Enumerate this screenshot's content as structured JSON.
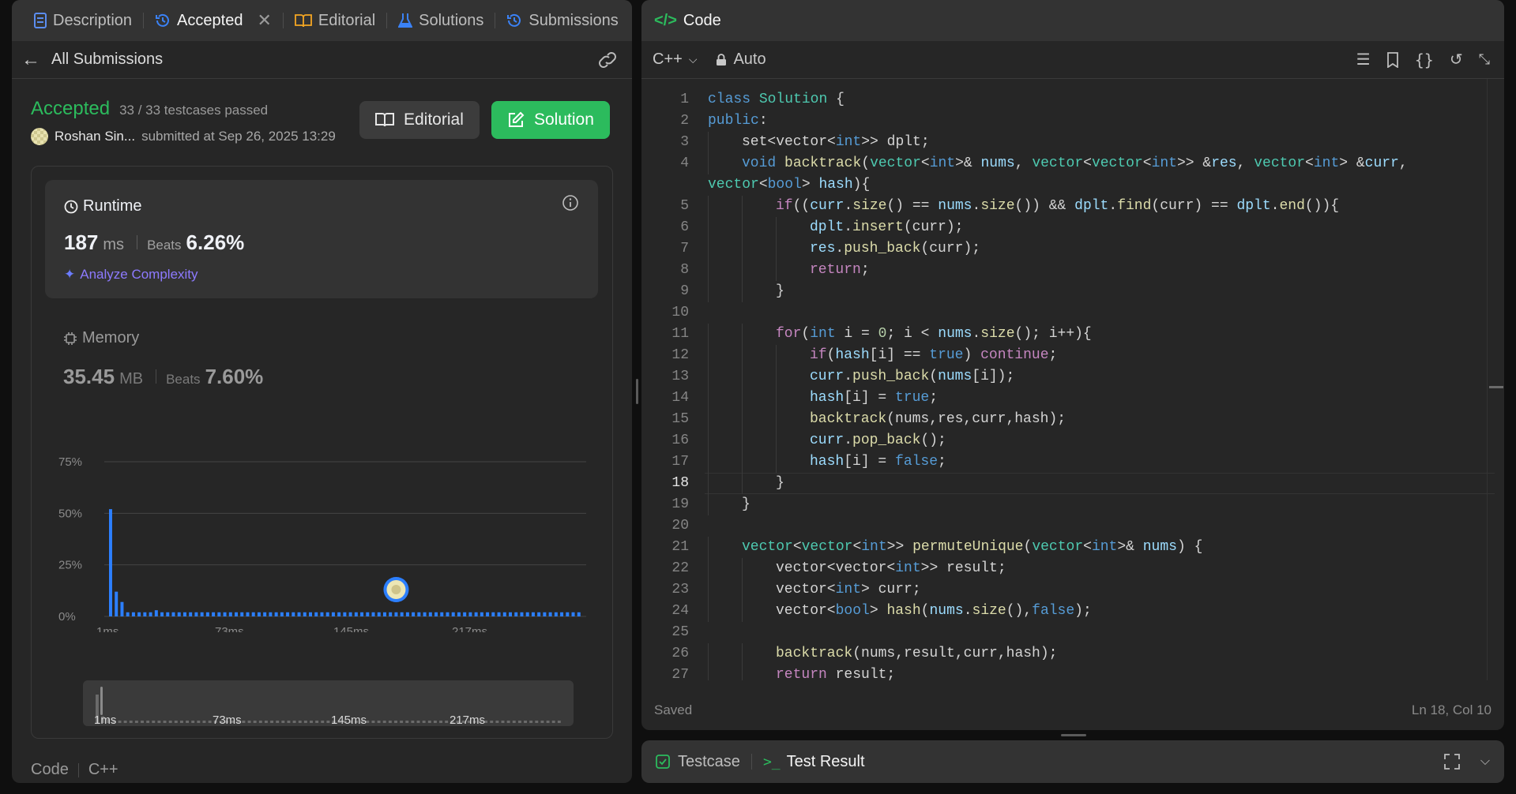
{
  "left_tabs": [
    {
      "label": "Description",
      "icon": "description-icon"
    },
    {
      "label": "Accepted",
      "icon": "history-icon"
    },
    {
      "label": "Editorial",
      "icon": "book-icon"
    },
    {
      "label": "Solutions",
      "icon": "flask-icon"
    },
    {
      "label": "Submissions",
      "icon": "history-icon"
    }
  ],
  "subheader": {
    "back_label": "All Submissions"
  },
  "result": {
    "status": "Accepted",
    "testcases": "33 / 33 testcases passed",
    "user": "Roshan Sin...",
    "submitted": "submitted at Sep 26, 2025 13:29",
    "editorial_btn": "Editorial",
    "solution_btn": "Solution"
  },
  "runtime": {
    "title": "Runtime",
    "value": "187",
    "unit": "ms",
    "beats_label": "Beats",
    "beats_value": "6.26%",
    "analyze": "Analyze Complexity"
  },
  "memory": {
    "title": "Memory",
    "value": "35.45",
    "unit": "MB",
    "beats_label": "Beats",
    "beats_value": "7.60%"
  },
  "chart_data": {
    "type": "bar",
    "y_ticks": [
      "75%",
      "50%",
      "25%",
      "0%"
    ],
    "ylim": [
      0,
      75
    ],
    "x_tick_labels": [
      "1ms",
      "73ms",
      "145ms",
      "217ms"
    ],
    "values": [
      52,
      12,
      7,
      2,
      2,
      2,
      2,
      2,
      3,
      2,
      2,
      2,
      2,
      2,
      2,
      2,
      2,
      2,
      2,
      2,
      2,
      2,
      2,
      2,
      2,
      2,
      2,
      2,
      2,
      2,
      2,
      2,
      2,
      2,
      2,
      2,
      2,
      2,
      2,
      2,
      2,
      2,
      2,
      2,
      2,
      2,
      2,
      2,
      2,
      2,
      2,
      2,
      2,
      2,
      2,
      2,
      2,
      2,
      2,
      2,
      2,
      2,
      2,
      2,
      2,
      2,
      2,
      2,
      2,
      2,
      2,
      2,
      2,
      2,
      2,
      2,
      2,
      2,
      2,
      2,
      2,
      2,
      2
    ],
    "your_position_index": 50,
    "bar_color": "#2c7fff"
  },
  "left_footer": {
    "code": "Code",
    "lang": "C++"
  },
  "code_panel": {
    "title": "Code",
    "language": "C++",
    "mode": "Auto",
    "status": "Saved",
    "cursor": "Ln 18, Col 10"
  },
  "code_lines": [
    {
      "n": "1",
      "indent": 0,
      "html": "<span class='kw'>class</span> <span class='ty'>Solution</span> <span class='pl'>{</span>"
    },
    {
      "n": "2",
      "indent": 0,
      "html": "<span class='kw'>public</span><span class='pl'>:</span>"
    },
    {
      "n": "3",
      "indent": 1,
      "html": "<span class='pl'>set&lt;vector&lt;</span><span class='kw'>int</span><span class='pl'>&gt;&gt; dplt;</span>"
    },
    {
      "n": "4",
      "indent": 1,
      "html": "<span class='kw'>void</span> <span class='fn'>backtrack</span><span class='pl'>(</span><span class='ty'>vector</span><span class='pl'>&lt;</span><span class='kw'>int</span><span class='pl'>&gt;&amp; </span><span class='vr'>nums</span><span class='pl'>, </span><span class='ty'>vector</span><span class='pl'>&lt;</span><span class='ty'>vector</span><span class='pl'>&lt;</span><span class='kw'>int</span><span class='pl'>&gt;&gt; &amp;</span><span class='vr'>res</span><span class='pl'>, </span><span class='ty'>vector</span><span class='pl'>&lt;</span><span class='kw'>int</span><span class='pl'>&gt; &amp;</span><span class='vr'>curr</span><span class='pl'>,</span>"
    },
    {
      "n": "",
      "indent": 0,
      "html": "<span class='ty'>vector</span><span class='pl'>&lt;</span><span class='kw'>bool</span><span class='pl'>&gt; </span><span class='vr'>hash</span><span class='pl'>){</span>"
    },
    {
      "n": "5",
      "indent": 2,
      "html": "<span class='pp'>if</span><span class='pl'>((</span><span class='vr'>curr</span><span class='pl'>.</span><span class='fn'>size</span><span class='pl'>() == </span><span class='vr'>nums</span><span class='pl'>.</span><span class='fn'>size</span><span class='pl'>()) &amp;&amp; </span><span class='vr'>dplt</span><span class='pl'>.</span><span class='fn'>find</span><span class='pl'>(curr) == </span><span class='vr'>dplt</span><span class='pl'>.</span><span class='fn'>end</span><span class='pl'>()){</span>"
    },
    {
      "n": "6",
      "indent": 3,
      "html": "<span class='vr'>dplt</span><span class='pl'>.</span><span class='fn'>insert</span><span class='pl'>(curr);</span>"
    },
    {
      "n": "7",
      "indent": 3,
      "html": "<span class='vr'>res</span><span class='pl'>.</span><span class='fn'>push_back</span><span class='pl'>(curr);</span>"
    },
    {
      "n": "8",
      "indent": 3,
      "html": "<span class='pp'>return</span><span class='pl'>;</span>"
    },
    {
      "n": "9",
      "indent": 2,
      "html": "<span class='pl'>}</span>"
    },
    {
      "n": "10",
      "indent": 0,
      "html": ""
    },
    {
      "n": "11",
      "indent": 2,
      "html": "<span class='pp'>for</span><span class='pl'>(</span><span class='kw'>int</span><span class='pl'> i = </span><span class='nu'>0</span><span class='pl'>; i &lt; </span><span class='vr'>nums</span><span class='pl'>.</span><span class='fn'>size</span><span class='pl'>(); i++){</span>"
    },
    {
      "n": "12",
      "indent": 3,
      "html": "<span class='pp'>if</span><span class='pl'>(</span><span class='vr'>hash</span><span class='pl'>[i] == </span><span class='kw'>true</span><span class='pl'>) </span><span class='pp'>continue</span><span class='pl'>;</span>"
    },
    {
      "n": "13",
      "indent": 3,
      "html": "<span class='vr'>curr</span><span class='pl'>.</span><span class='fn'>push_back</span><span class='pl'>(</span><span class='vr'>nums</span><span class='pl'>[i]);</span>"
    },
    {
      "n": "14",
      "indent": 3,
      "html": "<span class='vr'>hash</span><span class='pl'>[i] = </span><span class='kw'>true</span><span class='pl'>;</span>"
    },
    {
      "n": "15",
      "indent": 3,
      "html": "<span class='fn'>backtrack</span><span class='pl'>(nums,res,curr,hash);</span>"
    },
    {
      "n": "16",
      "indent": 3,
      "html": "<span class='vr'>curr</span><span class='pl'>.</span><span class='fn'>pop_back</span><span class='pl'>();</span>"
    },
    {
      "n": "17",
      "indent": 3,
      "html": "<span class='vr'>hash</span><span class='pl'>[i] = </span><span class='kw'>false</span><span class='pl'>;</span>"
    },
    {
      "n": "18",
      "indent": 2,
      "html": "<span class='pl'>}</span>"
    },
    {
      "n": "19",
      "indent": 1,
      "html": "<span class='pl'>}</span>"
    },
    {
      "n": "20",
      "indent": 0,
      "html": ""
    },
    {
      "n": "21",
      "indent": 1,
      "html": "<span class='ty'>vector</span><span class='pl'>&lt;</span><span class='ty'>vector</span><span class='pl'>&lt;</span><span class='kw'>int</span><span class='pl'>&gt;&gt; </span><span class='fn'>permuteUnique</span><span class='pl'>(</span><span class='ty'>vector</span><span class='pl'>&lt;</span><span class='kw'>int</span><span class='pl'>&gt;&amp; </span><span class='vr'>nums</span><span class='pl'>) {</span>"
    },
    {
      "n": "22",
      "indent": 2,
      "html": "<span class='pl'>vector&lt;vector&lt;</span><span class='kw'>int</span><span class='pl'>&gt;&gt; result;</span>"
    },
    {
      "n": "23",
      "indent": 2,
      "html": "<span class='pl'>vector&lt;</span><span class='kw'>int</span><span class='pl'>&gt; curr;</span>"
    },
    {
      "n": "24",
      "indent": 2,
      "html": "<span class='pl'>vector&lt;</span><span class='kw'>bool</span><span class='pl'>&gt; </span><span class='fn'>hash</span><span class='pl'>(</span><span class='vr'>nums</span><span class='pl'>.</span><span class='fn'>size</span><span class='pl'>(),</span><span class='kw'>false</span><span class='pl'>);</span>"
    },
    {
      "n": "25",
      "indent": 0,
      "html": ""
    },
    {
      "n": "26",
      "indent": 2,
      "html": "<span class='fn'>backtrack</span><span class='pl'>(nums,result,curr,hash);</span>"
    },
    {
      "n": "27",
      "indent": 2,
      "html": "<span class='pp'>return</span><span class='pl'> result;</span>"
    }
  ],
  "bottom_tabs": {
    "testcase": "Testcase",
    "result": "Test Result"
  }
}
